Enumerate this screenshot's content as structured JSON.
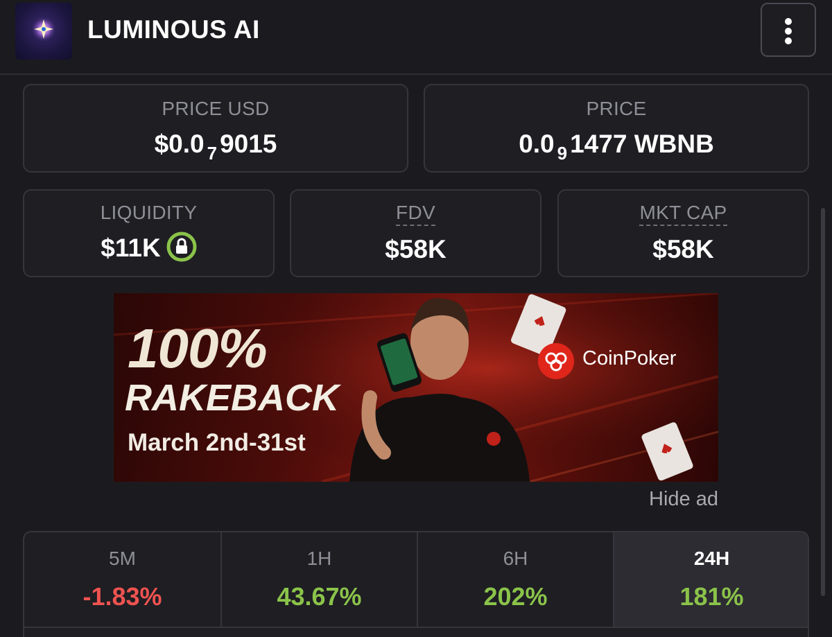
{
  "header": {
    "title": "LUMINOUS AI",
    "logo_icon": "luminous-star-logo",
    "menu_icon": "more-vertical-icon"
  },
  "stats": {
    "price_usd": {
      "label": "PRICE USD",
      "prefix": "$0.0",
      "zero_count": "7",
      "suffix": "9015"
    },
    "price_native": {
      "label": "PRICE",
      "prefix": "0.0",
      "zero_count": "9",
      "suffix": "1477 WBNB"
    },
    "liquidity": {
      "label": "LIQUIDITY",
      "value": "$11K",
      "lock_icon": "lock-icon",
      "lock_color": "#8bc34a"
    },
    "fdv": {
      "label": "FDV",
      "value": "$58K"
    },
    "mkt_cap": {
      "label": "MKT CAP",
      "value": "$58K"
    }
  },
  "ad": {
    "headline": "100%",
    "subheadline": "RAKEBACK",
    "dates": "March 2nd-31st",
    "brand": "CoinPoker",
    "brand_color": "#e0261b",
    "hide_label": "Hide ad"
  },
  "timeframes": [
    {
      "label": "5M",
      "value": "-1.83%",
      "color": "#ef5350",
      "active": false
    },
    {
      "label": "1H",
      "value": "43.67%",
      "color": "#8bc34a",
      "active": false
    },
    {
      "label": "6H",
      "value": "202%",
      "color": "#8bc34a",
      "active": false
    },
    {
      "label": "24H",
      "value": "181%",
      "color": "#8bc34a",
      "active": true
    }
  ],
  "colors": {
    "background": "#1b1b1f",
    "card_border": "#35353c",
    "positive": "#8bc34a",
    "negative": "#ef5350"
  }
}
